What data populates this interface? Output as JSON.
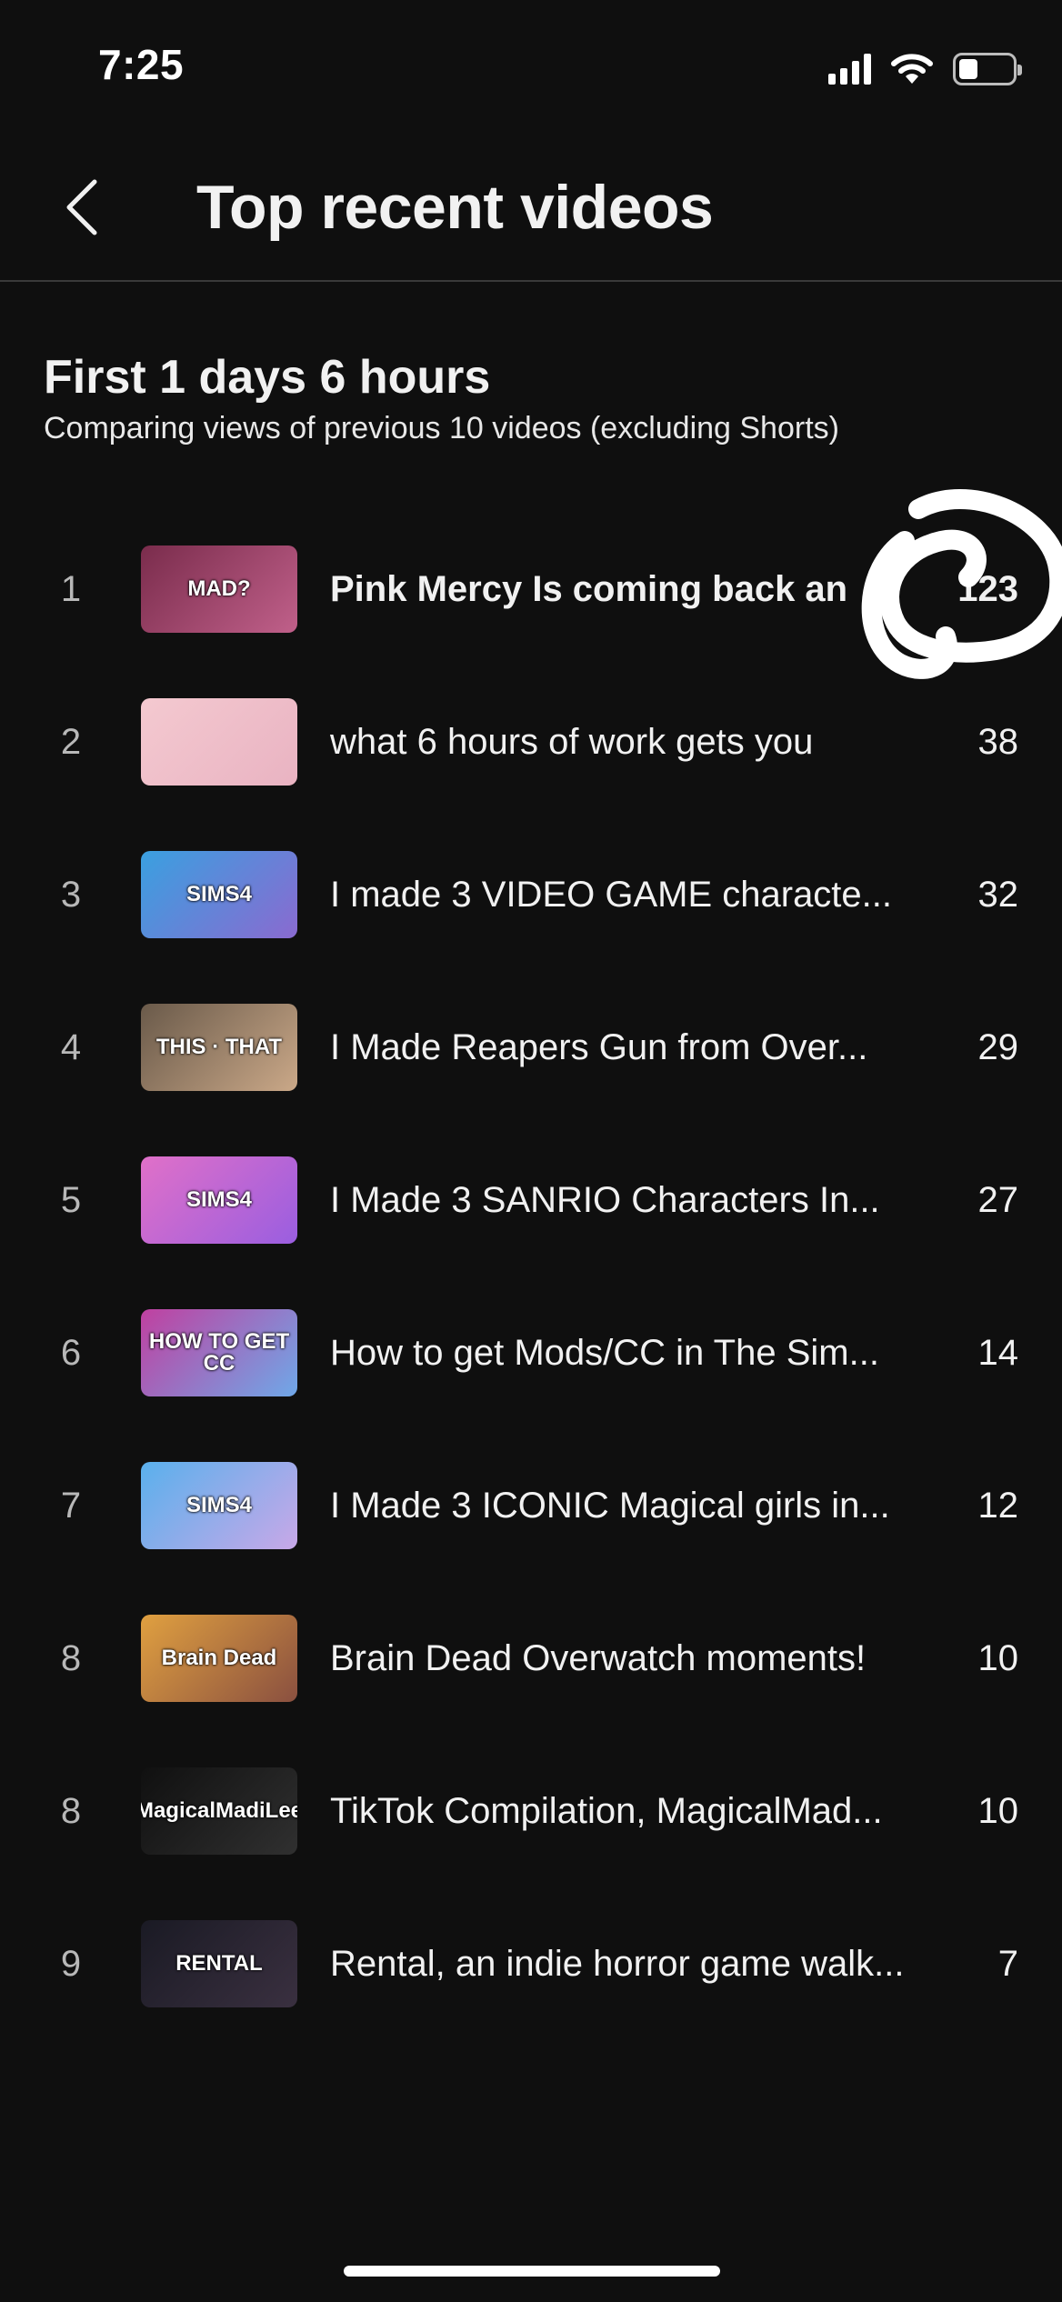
{
  "status_bar": {
    "time": "7:25",
    "icons": [
      "cellular-signal-icon",
      "wifi-icon",
      "battery-icon"
    ],
    "battery_level": 0.35
  },
  "header": {
    "back_icon": "chevron-left-icon",
    "title": "Top recent videos"
  },
  "section": {
    "title": "First 1 days 6 hours",
    "subtitle": "Comparing views of previous 10 videos (excluding Shorts)"
  },
  "videos": [
    {
      "rank": "1",
      "title": "Pink Mercy Is coming back an",
      "views": "123",
      "thumb_text": "MAD?",
      "thumb_colors": [
        "#7a2c4c",
        "#c0608a"
      ]
    },
    {
      "rank": "2",
      "title": "what 6 hours of work gets you",
      "views": "38",
      "thumb_text": "",
      "thumb_colors": [
        "#f4c9d0",
        "#e9b3c2"
      ]
    },
    {
      "rank": "3",
      "title": "I made 3 VIDEO GAME characte...",
      "views": "32",
      "thumb_text": "SIMS4",
      "thumb_colors": [
        "#3aa0e0",
        "#8a6ad0"
      ]
    },
    {
      "rank": "4",
      "title": "I Made Reapers Gun from Over...",
      "views": "29",
      "thumb_text": "THIS · THAT",
      "thumb_colors": [
        "#6a5a4a",
        "#caa888"
      ]
    },
    {
      "rank": "5",
      "title": "I Made 3 SANRIO Characters In...",
      "views": "27",
      "thumb_text": "SIMS4",
      "thumb_colors": [
        "#e070c8",
        "#9a5ee0"
      ]
    },
    {
      "rank": "6",
      "title": "How to get Mods/CC in The Sim...",
      "views": "14",
      "thumb_text": "HOW TO GET CC",
      "thumb_colors": [
        "#c040a0",
        "#6fa8e8"
      ]
    },
    {
      "rank": "7",
      "title": "I Made 3 ICONIC Magical girls in...",
      "views": "12",
      "thumb_text": "SIMS4",
      "thumb_colors": [
        "#5ab0ec",
        "#c8a8e8"
      ]
    },
    {
      "rank": "8",
      "title": "Brain Dead Overwatch moments!",
      "views": "10",
      "thumb_text": "Brain Dead",
      "thumb_colors": [
        "#e0a040",
        "#8a5040"
      ]
    },
    {
      "rank": "8",
      "title": "TikTok Compilation, MagicalMad...",
      "views": "10",
      "thumb_text": "MagicalMadiLee",
      "thumb_colors": [
        "#101010",
        "#303030"
      ]
    },
    {
      "rank": "9",
      "title": "Rental, an indie horror game walk...",
      "views": "7",
      "thumb_text": "RENTAL",
      "thumb_colors": [
        "#1a1a24",
        "#3a3040"
      ]
    }
  ],
  "colors": {
    "background": "#0f0f0f",
    "text_primary": "#f1f1f1",
    "text_secondary": "#b8b8b8",
    "divider": "#3a3a3a"
  }
}
